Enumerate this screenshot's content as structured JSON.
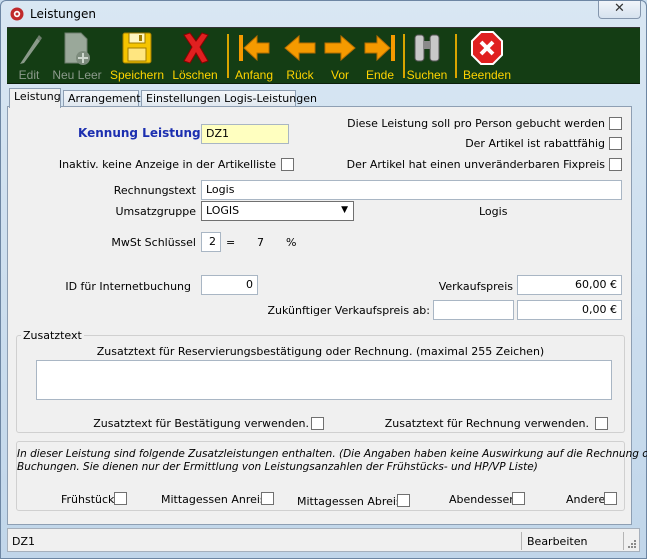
{
  "window": {
    "title": "Leistungen",
    "close_label": "✕"
  },
  "toolbar": {
    "edit": "Edit",
    "new_empty": "Neu Leer",
    "save": "Speichern",
    "delete": "Löschen",
    "first": "Anfang",
    "back": "Rück",
    "forward": "Vor",
    "last": "Ende",
    "search": "Suchen",
    "exit": "Beenden"
  },
  "tabs": [
    {
      "label": "Leistung"
    },
    {
      "label": "Arrangements"
    },
    {
      "label": "Einstellungen Logis-Leistungen"
    }
  ],
  "form": {
    "kennung_label": "Kennung Leistung",
    "kennung_value": "DZ1",
    "per_person_label": "Diese Leistung soll pro Person gebucht werden",
    "rabatt_label": "Der Artikel ist rabattfähig",
    "inaktiv_label": "Inaktiv. keine Anzeige in der Artikelliste",
    "fixpreis_label": "Der Artikel hat einen unveränderbaren Fixpreis",
    "rechnungstext_label": "Rechnungstext",
    "rechnungstext_value": "Logis",
    "umsatzgruppe_label": "Umsatzgruppe",
    "umsatzgruppe_value": "LOGIS",
    "umsatzgruppe_name": "Logis",
    "mwst_label": "MwSt Schlüssel",
    "mwst_value": "2",
    "mwst_eq": "=",
    "mwst_rate": "7",
    "mwst_pct": "%",
    "internet_id_label": "ID für Internetbuchung",
    "internet_id_value": "0",
    "verkaufspreis_label": "Verkaufspreis",
    "verkaufspreis_value": "60,00 €",
    "zukunft_label": "Zukünftiger Verkaufspreis ab:",
    "zukunft_date": "",
    "zukunft_value": "0,00 €"
  },
  "zusatztext": {
    "group_title": "Zusatztext",
    "hint": "Zusatztext für Reservierungsbestätigung oder Rechnung. (maximal 255 Zeichen)",
    "text": "",
    "bestaetigung_label": "Zusatztext für Bestätigung verwenden.",
    "rechnung_label": "Zusatztext für Rechnung verwenden."
  },
  "zusatzleistungen": {
    "note_line1": "In dieser Leistung sind folgende Zusatzleistungen enthalten.  (Die Angaben haben keine Auswirkung auf die Rechnung oder",
    "note_line2": "Buchungen. Sie dienen nur der Ermittlung von Leistungsanzahlen der Frühstücks- und HP/VP Liste)",
    "fruehstueck": "Frühstück",
    "mittag_anreise": "Mittagessen Anreise",
    "mittag_abreise": "Mittagessen Abreise",
    "abendessen": "Abendessen",
    "andere": "Andere"
  },
  "status": {
    "record": "DZ1",
    "mode": "Bearbeiten"
  },
  "colors": {
    "toolbar_bg": "#143d14",
    "toolbar_label": "#ffd400",
    "kennung_label": "#1c2fb0",
    "kennung_field_bg": "#ffffc0"
  }
}
